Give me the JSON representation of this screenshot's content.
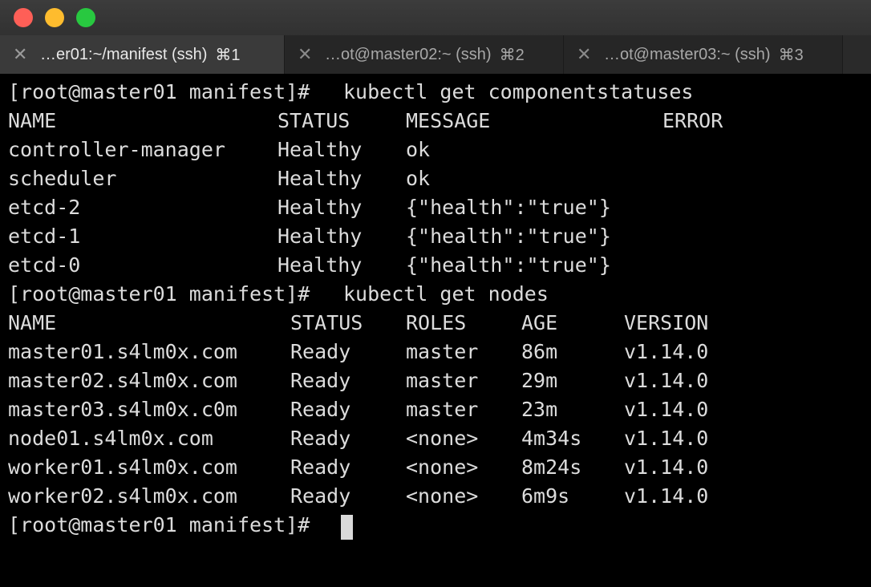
{
  "tabs": [
    {
      "title": "…er01:~/manifest (ssh)",
      "shortcut": "⌘1",
      "active": true
    },
    {
      "title": "…ot@master02:~ (ssh)",
      "shortcut": "⌘2",
      "active": false
    },
    {
      "title": "…ot@master03:~ (ssh)",
      "shortcut": "⌘3",
      "active": false
    }
  ],
  "close_glyph": "✕",
  "prompt": "[root@master01 manifest]#",
  "commands": {
    "cs": "kubectl get componentstatuses",
    "nodes": "kubectl get nodes"
  },
  "componentstatuses": {
    "headers": [
      "NAME",
      "STATUS",
      "MESSAGE",
      "ERROR"
    ],
    "rows": [
      [
        "controller-manager",
        "Healthy",
        "ok"
      ],
      [
        "scheduler",
        "Healthy",
        "ok"
      ],
      [
        "etcd-2",
        "Healthy",
        "{\"health\":\"true\"}"
      ],
      [
        "etcd-1",
        "Healthy",
        "{\"health\":\"true\"}"
      ],
      [
        "etcd-0",
        "Healthy",
        "{\"health\":\"true\"}"
      ]
    ]
  },
  "nodes": {
    "headers": [
      "NAME",
      "STATUS",
      "ROLES",
      "AGE",
      "VERSION"
    ],
    "rows": [
      [
        "master01.s4lm0x.com",
        "Ready",
        "master",
        "86m",
        "v1.14.0"
      ],
      [
        "master02.s4lm0x.com",
        "Ready",
        "master",
        "29m",
        "v1.14.0"
      ],
      [
        "master03.s4lm0x.c0m",
        "Ready",
        "master",
        "23m",
        "v1.14.0"
      ],
      [
        "node01.s4lm0x.com",
        "Ready",
        "<none>",
        "4m34s",
        "v1.14.0"
      ],
      [
        "worker01.s4lm0x.com",
        "Ready",
        "<none>",
        "8m24s",
        "v1.14.0"
      ],
      [
        "worker02.s4lm0x.com",
        "Ready",
        "<none>",
        "6m9s",
        "v1.14.0"
      ]
    ]
  },
  "colors": {
    "terminal_bg": "#000000",
    "terminal_fg": "#dcdcdc",
    "titlebar_bg": "#353535",
    "active_tab_bg": "#3a3a3a",
    "traffic_red": "#fe5f57",
    "traffic_yellow": "#febc2e",
    "traffic_green": "#28c840"
  }
}
